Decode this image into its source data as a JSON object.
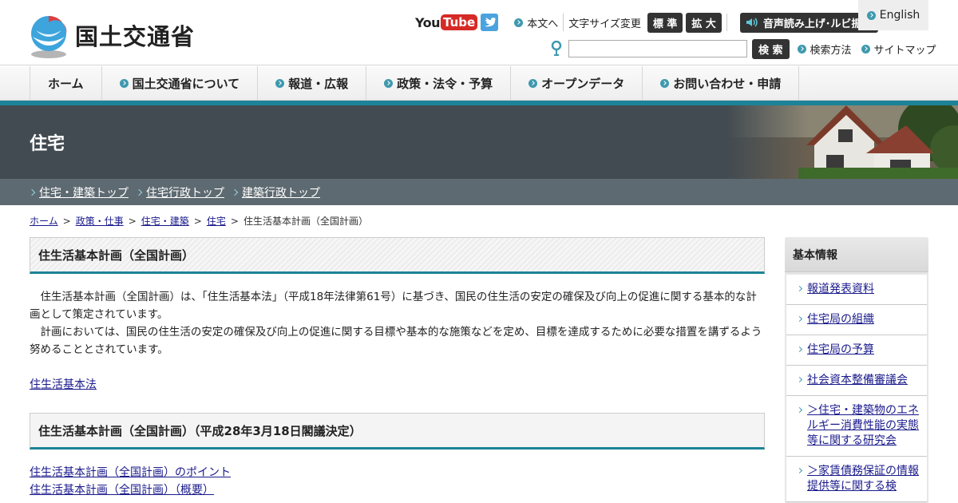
{
  "header": {
    "logo_text": "国土交通省",
    "youtube_you": "You",
    "youtube_tube": "Tube",
    "skip_link": "本文へ",
    "font_size_label": "文字サイズ変更",
    "font_standard": "標 準",
    "font_large": "拡 大",
    "voice_button": "音声読み上げ･ルビ振り",
    "english": "English",
    "search_button": "検 索",
    "search_input_value": "",
    "search_method": "検索方法",
    "sitemap": "サイトマップ"
  },
  "nav": {
    "items": [
      {
        "label": "ホーム",
        "bullet": false
      },
      {
        "label": "国土交通省について",
        "bullet": true
      },
      {
        "label": "報道・広報",
        "bullet": true
      },
      {
        "label": "政策・法令・予算",
        "bullet": true
      },
      {
        "label": "オープンデータ",
        "bullet": true
      },
      {
        "label": "お問い合わせ・申請",
        "bullet": true
      }
    ]
  },
  "banner": {
    "title": "住宅"
  },
  "subnav": {
    "items": [
      "住宅・建築トップ",
      "住宅行政トップ",
      "建築行政トップ"
    ]
  },
  "breadcrumb": {
    "items": [
      "ホーム",
      "政策・仕事",
      "住宅・建築",
      "住宅"
    ],
    "current": "住生活基本計画（全国計画）",
    "separator": ">"
  },
  "main": {
    "heading": "住生活基本計画（全国計画）",
    "paragraph1": "住生活基本計画（全国計画）は、「住生活基本法」（平成18年法律第61号）に基づき、国民の住生活の安定の確保及び向上の促進に関する基本的な計画として策定されています。",
    "paragraph2": "計画においては、国民の住生活の安定の確保及び向上の促進に関する目標や基本的な施策などを定め、目標を達成するために必要な措置を講ずるよう努めることとされています。",
    "law_link": "住生活基本法",
    "heading2": "住生活基本計画（全国計画）（平成28年3月18日閣議決定）",
    "links": [
      "住生活基本計画（全国計画）のポイント",
      "住生活基本計画（全国計画）（概要）"
    ]
  },
  "sidebar": {
    "title": "基本情報",
    "items": [
      "報道発表資料",
      "住宅局の組織",
      "住宅局の予算",
      "社会資本整備審議会",
      "＞住宅・建築物のエネルギー消費性能の実態等に関する研究会",
      "＞家賃債務保証の情報提供等に関する検"
    ]
  },
  "colors": {
    "accent": "#1d8397",
    "banner_bg": "#424b51",
    "subnav_bg": "#5e6a71",
    "link": "#1a1a8c"
  }
}
